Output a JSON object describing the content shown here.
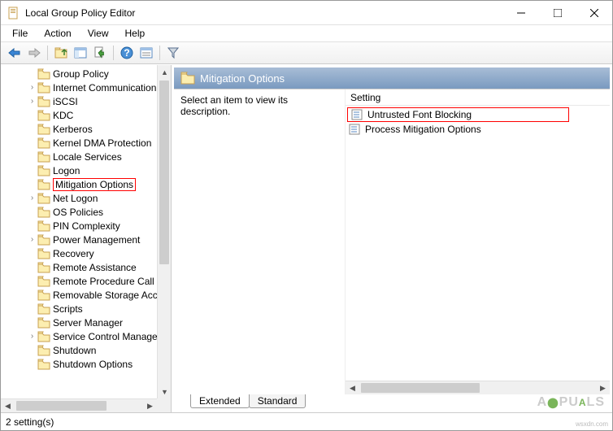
{
  "window": {
    "title": "Local Group Policy Editor"
  },
  "menu": [
    "File",
    "Action",
    "View",
    "Help"
  ],
  "tree": {
    "items": [
      {
        "label": "Group Policy",
        "indent": 2,
        "expander": ""
      },
      {
        "label": "Internet Communication N",
        "indent": 2,
        "expander": "›"
      },
      {
        "label": "iSCSI",
        "indent": 2,
        "expander": "›"
      },
      {
        "label": "KDC",
        "indent": 2,
        "expander": ""
      },
      {
        "label": "Kerberos",
        "indent": 2,
        "expander": ""
      },
      {
        "label": "Kernel DMA Protection",
        "indent": 2,
        "expander": ""
      },
      {
        "label": "Locale Services",
        "indent": 2,
        "expander": ""
      },
      {
        "label": "Logon",
        "indent": 2,
        "expander": ""
      },
      {
        "label": "Mitigation Options",
        "indent": 2,
        "expander": "",
        "selected": true
      },
      {
        "label": "Net Logon",
        "indent": 2,
        "expander": "›"
      },
      {
        "label": "OS Policies",
        "indent": 2,
        "expander": ""
      },
      {
        "label": "PIN Complexity",
        "indent": 2,
        "expander": ""
      },
      {
        "label": "Power Management",
        "indent": 2,
        "expander": "›"
      },
      {
        "label": "Recovery",
        "indent": 2,
        "expander": ""
      },
      {
        "label": "Remote Assistance",
        "indent": 2,
        "expander": ""
      },
      {
        "label": "Remote Procedure Call",
        "indent": 2,
        "expander": ""
      },
      {
        "label": "Removable Storage Acces",
        "indent": 2,
        "expander": ""
      },
      {
        "label": "Scripts",
        "indent": 2,
        "expander": ""
      },
      {
        "label": "Server Manager",
        "indent": 2,
        "expander": ""
      },
      {
        "label": "Service Control Manager S",
        "indent": 2,
        "expander": "›"
      },
      {
        "label": "Shutdown",
        "indent": 2,
        "expander": ""
      },
      {
        "label": "Shutdown Options",
        "indent": 2,
        "expander": ""
      }
    ]
  },
  "detail": {
    "header": "Mitigation Options",
    "description": "Select an item to view its description.",
    "column_header": "Setting",
    "rows": [
      {
        "label": "Untrusted Font Blocking",
        "hl": true
      },
      {
        "label": "Process Mitigation Options",
        "hl": false
      }
    ],
    "tabs": [
      "Extended",
      "Standard"
    ],
    "active_tab": 0
  },
  "status": "2 setting(s)",
  "watermark": "APPUALS",
  "watermark_url": "wsxdn.com"
}
